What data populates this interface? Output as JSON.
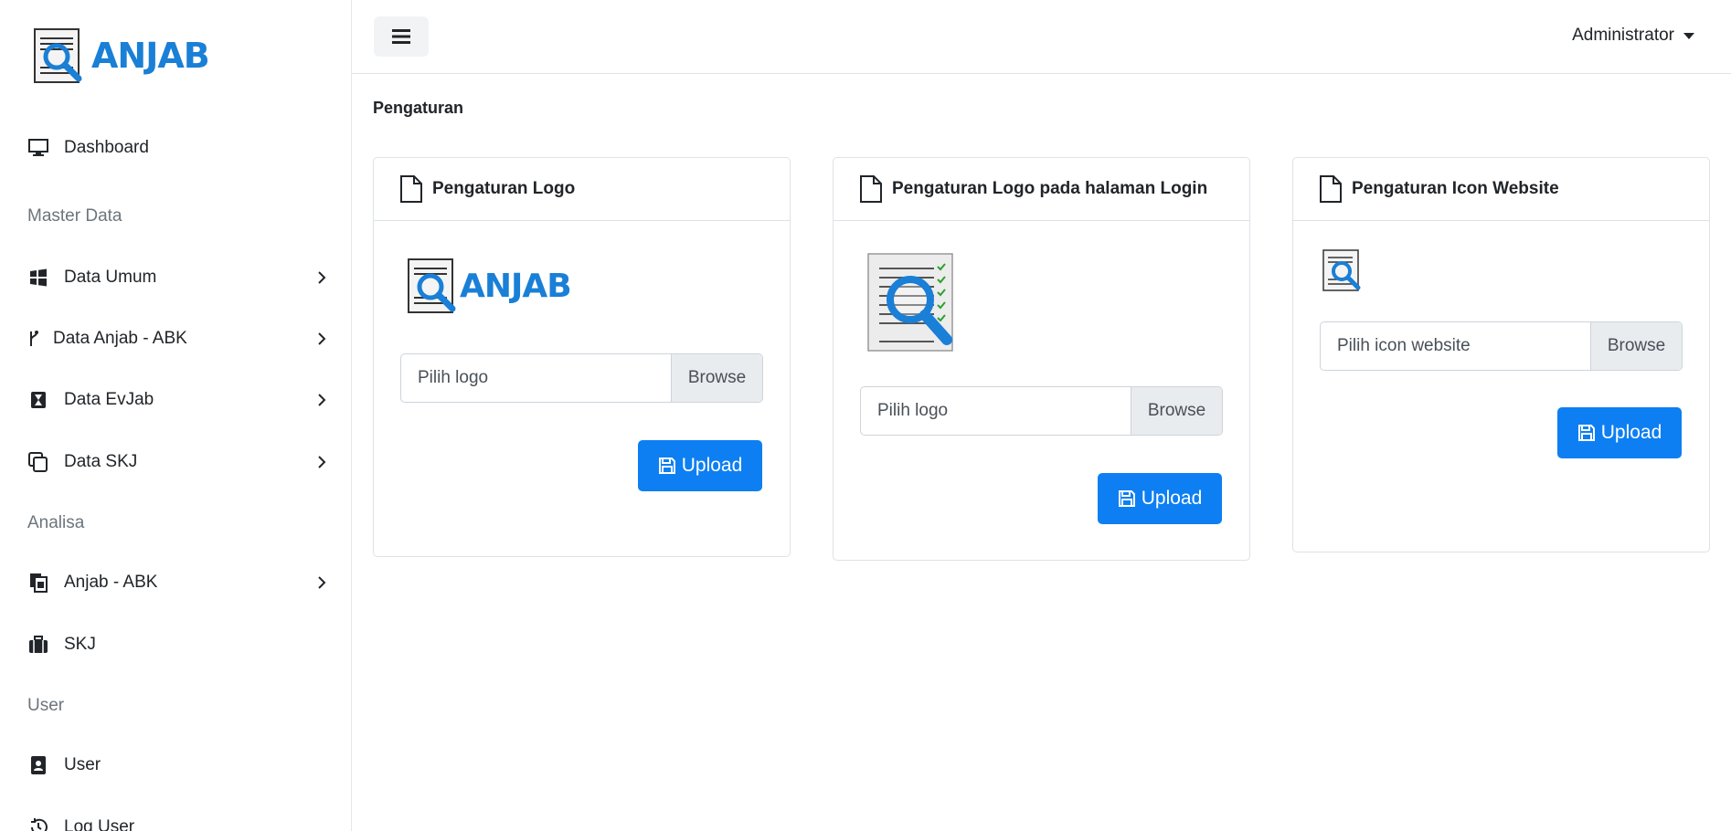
{
  "brand": {
    "name": "ANJAB"
  },
  "sidebar": {
    "items": [
      {
        "label": "Dashboard",
        "icon": "monitor-icon",
        "has_children": false
      },
      {
        "label": "Data Umum",
        "icon": "windows-icon",
        "has_children": true
      },
      {
        "label": "Data Anjab - ABK",
        "icon": "branch-icon",
        "has_children": true
      },
      {
        "label": "Data EvJab",
        "icon": "hourglass-icon",
        "has_children": true
      },
      {
        "label": "Data SKJ",
        "icon": "copy-icon",
        "has_children": true
      },
      {
        "label": "Anjab - ABK",
        "icon": "files-icon",
        "has_children": true
      },
      {
        "label": "SKJ",
        "icon": "briefcase-icon",
        "has_children": false
      },
      {
        "label": "User",
        "icon": "contact-book-icon",
        "has_children": false
      },
      {
        "label": "Log User",
        "icon": "history-icon",
        "has_children": false
      }
    ],
    "sections": [
      "Master Data",
      "Analisa",
      "User"
    ]
  },
  "topbar": {
    "menu_icon": "hamburger-icon",
    "user": "Administrator"
  },
  "page": {
    "title": "Pengaturan"
  },
  "cards": [
    {
      "title": "Pengaturan Logo",
      "preview_text": "ANJAB",
      "placeholder": "Pilih logo",
      "browse": "Browse",
      "upload": "Upload"
    },
    {
      "title": "Pengaturan Logo pada halaman Login",
      "placeholder": "Pilih logo",
      "browse": "Browse",
      "upload": "Upload"
    },
    {
      "title": "Pengaturan Icon Website",
      "placeholder": "Pilih icon website",
      "browse": "Browse",
      "upload": "Upload"
    }
  ],
  "colors": {
    "accent": "#0d7ff2",
    "brand": "#1a7fd6",
    "muted": "#6c757d",
    "border": "#dee2e6"
  }
}
